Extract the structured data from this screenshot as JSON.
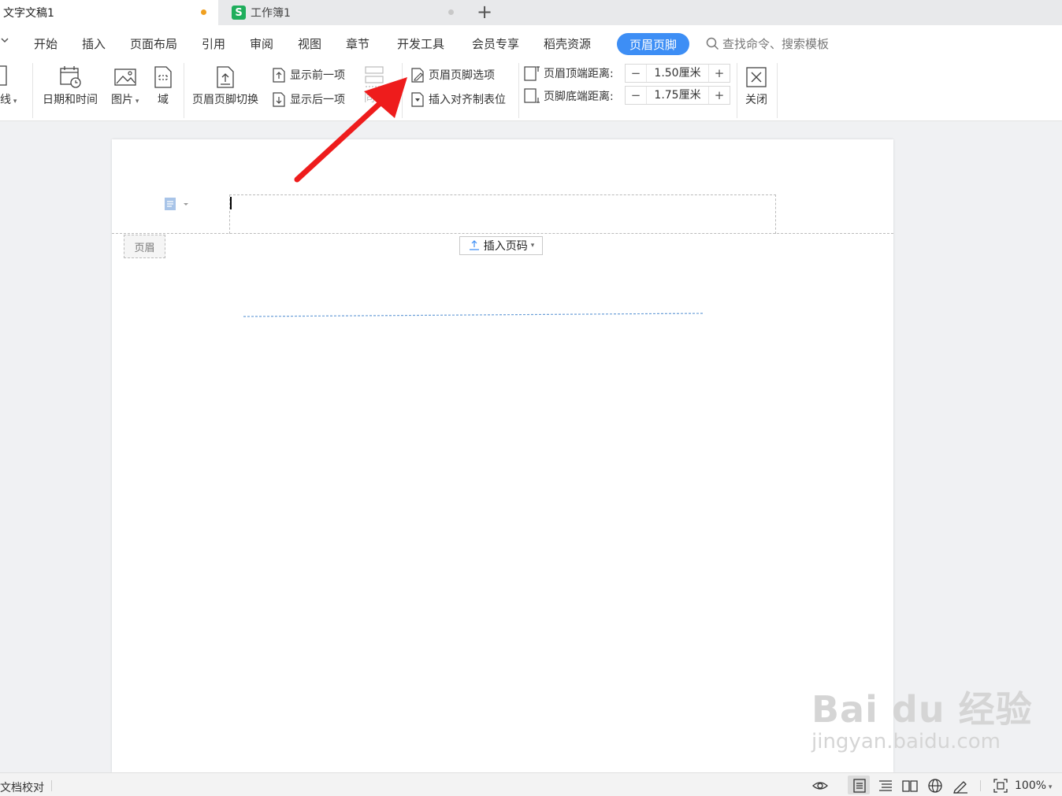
{
  "tabs": {
    "doc_title": "文字文稿1",
    "sheet_title": "工作簿1",
    "sheet_icon_letter": "S"
  },
  "menu": {
    "items": [
      "开始",
      "插入",
      "页面布局",
      "引用",
      "审阅",
      "视图",
      "章节",
      "开发工具",
      "会员专享",
      "稻壳资源"
    ],
    "active": "页眉页脚",
    "search_placeholder": "查找命令、搜索模板"
  },
  "ribbon": {
    "partial_left": "线",
    "datetime": "日期和时间",
    "picture": "图片",
    "field": "域",
    "switch": "页眉页脚切换",
    "show_prev": "显示前一项",
    "show_next": "显示后一项",
    "same_partial": "同",
    "options": "页眉页脚选项",
    "insert_tab": "插入对齐制表位",
    "header_top_label": "页眉顶端距离:",
    "header_top_value": "1.50厘米",
    "footer_bottom_label": "页脚底端距离:",
    "footer_bottom_value": "1.75厘米",
    "close": "关闭"
  },
  "document": {
    "header_tag": "页眉",
    "insert_page_number": "插入页码"
  },
  "status": {
    "proofread": "文档校对",
    "zoom": "100%"
  },
  "watermark": {
    "brand": "Bai du 经验",
    "url": "jingyan.baidu.com"
  },
  "colors": {
    "accent": "#3d8ef5",
    "arrow": "#ee1c1c",
    "sheet_green": "#1fae5c",
    "modified_dot": "#f0a020"
  }
}
